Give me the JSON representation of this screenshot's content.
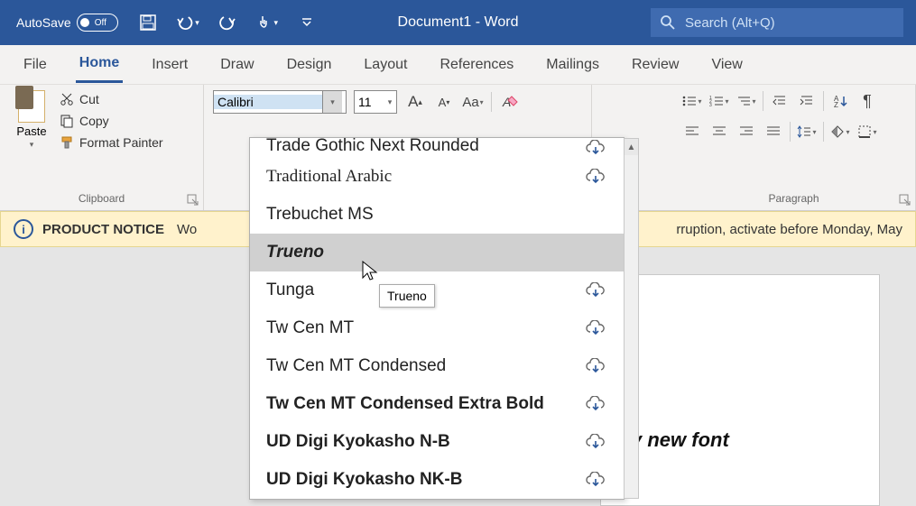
{
  "titlebar": {
    "autosave_label": "AutoSave",
    "autosave_state": "Off",
    "document_title": "Document1  -  Word",
    "search_placeholder": "Search (Alt+Q)"
  },
  "tabs": {
    "file": "File",
    "home": "Home",
    "insert": "Insert",
    "draw": "Draw",
    "design": "Design",
    "layout": "Layout",
    "references": "References",
    "mailings": "Mailings",
    "review": "Review",
    "view": "View"
  },
  "clipboard": {
    "paste": "Paste",
    "cut": "Cut",
    "copy": "Copy",
    "format_painter": "Format Painter",
    "group_label": "Clipboard"
  },
  "font": {
    "name_value": "Calibri",
    "size_value": "11",
    "case_label": "Aa"
  },
  "paragraph": {
    "group_label": "Paragraph"
  },
  "notice": {
    "badge": "PRODUCT NOTICE",
    "left_text": "Wo",
    "right_text": "rruption, activate before Monday, May"
  },
  "document": {
    "visible_text": "f my new font"
  },
  "font_dropdown": {
    "items": [
      {
        "label": "Trade Gothic Next Rounded",
        "cloud": true,
        "style": "font-weight:400;",
        "cut": true
      },
      {
        "label": "Traditional Arabic",
        "cloud": true,
        "style": "font-family:'Times New Roman',serif;"
      },
      {
        "label": "Trebuchet MS",
        "cloud": false,
        "style": "font-family:'Trebuchet MS',sans-serif;"
      },
      {
        "label": "Trueno",
        "cloud": false,
        "style": "font-weight:900; font-style:italic;",
        "hover": true
      },
      {
        "label": "Tunga",
        "cloud": true,
        "style": ""
      },
      {
        "label": "Tw Cen MT",
        "cloud": true,
        "style": "font-family:'Trebuchet MS',sans-serif;"
      },
      {
        "label": "Tw Cen MT Condensed",
        "cloud": true,
        "style": "font-family:'Arial Narrow',sans-serif; font-stretch:condensed;"
      },
      {
        "label": "Tw Cen MT Condensed Extra Bold",
        "cloud": true,
        "style": "font-family:'Arial Narrow',sans-serif; font-weight:900;"
      },
      {
        "label": "UD Digi Kyokasho N-B",
        "cloud": true,
        "style": "font-weight:600;"
      },
      {
        "label": "UD Digi Kyokasho NK-B",
        "cloud": true,
        "style": "font-weight:600;"
      }
    ],
    "tooltip": "Trueno"
  }
}
